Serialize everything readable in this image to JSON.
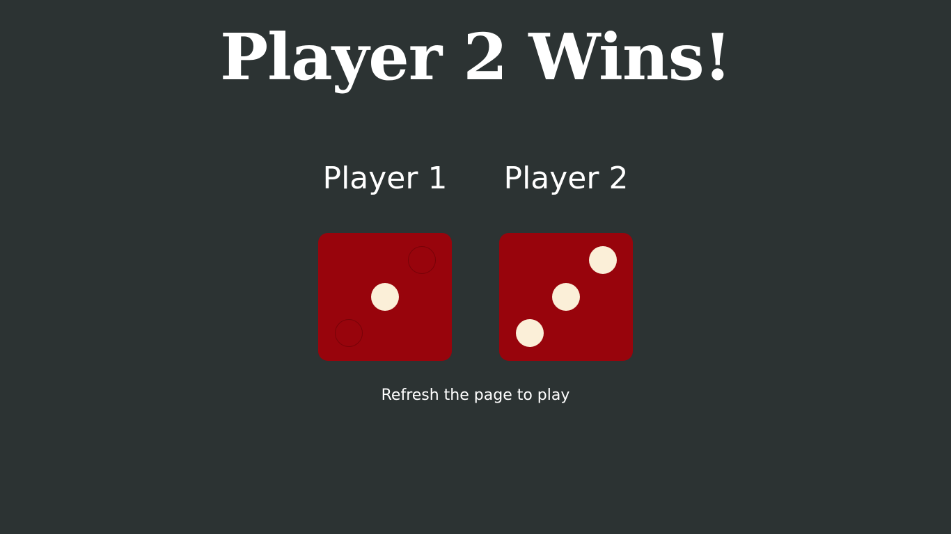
{
  "result": {
    "title": "Player 2 Wins!"
  },
  "players": [
    {
      "name": "Player 1",
      "die_value": 1
    },
    {
      "name": "Player 2",
      "die_value": 3
    }
  ],
  "hint": "Refresh the page to play",
  "colors": {
    "background": "#2c3333",
    "die": "#98040c",
    "pip": "#fbefd8",
    "text": "#ffffff"
  }
}
